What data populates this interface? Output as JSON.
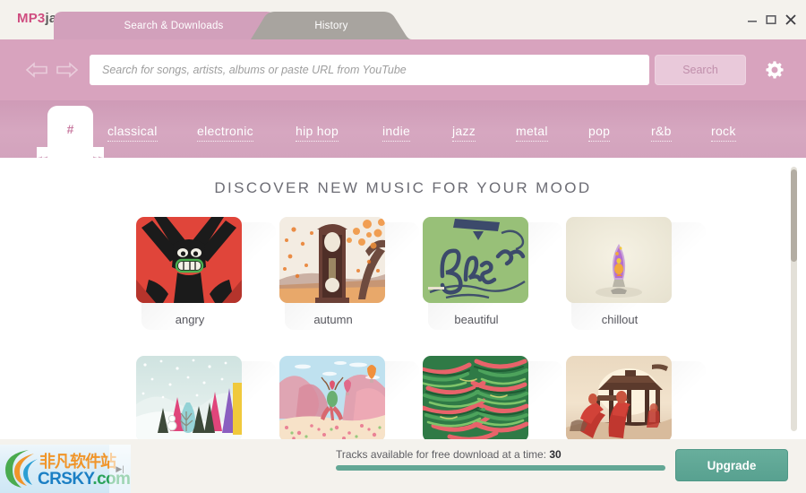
{
  "app": {
    "logo_mp3": "MP3",
    "logo_jam": "jam"
  },
  "window_controls": {
    "minimize": "minimize-icon",
    "maximize": "maximize-icon",
    "close": "close-icon"
  },
  "tabs": [
    {
      "label": "Search & Downloads",
      "active": true
    },
    {
      "label": "History",
      "active": false
    }
  ],
  "search": {
    "placeholder": "Search for songs, artists, albums or paste URL from YouTube",
    "value": "",
    "button_label": "Search",
    "back_icon": "arrow-left-icon",
    "forward_icon": "arrow-right-icon",
    "settings_icon": "gear-icon"
  },
  "genres": [
    {
      "label": "#",
      "active": true
    },
    {
      "label": "classical",
      "active": false
    },
    {
      "label": "electronic",
      "active": false
    },
    {
      "label": "hip hop",
      "active": false
    },
    {
      "label": "indie",
      "active": false
    },
    {
      "label": "jazz",
      "active": false
    },
    {
      "label": "metal",
      "active": false
    },
    {
      "label": "pop",
      "active": false
    },
    {
      "label": "r&b",
      "active": false
    },
    {
      "label": "rock",
      "active": false
    }
  ],
  "main": {
    "heading": "DISCOVER NEW MUSIC FOR YOUR MOOD",
    "moods_row1": [
      {
        "label": "angry"
      },
      {
        "label": "autumn"
      },
      {
        "label": "beautiful"
      },
      {
        "label": "chillout"
      }
    ],
    "moods_row2": [
      {
        "label": ""
      },
      {
        "label": ""
      },
      {
        "label": ""
      },
      {
        "label": ""
      }
    ]
  },
  "footer": {
    "tracks_text": "Tracks available for free download at a time:",
    "tracks_count": "30",
    "upgrade_label": "Upgrade",
    "progress_percent": "100"
  },
  "watermark": {
    "cn_text": "非凡软件站",
    "en_text_1": "CRSKY",
    "en_text_2": ".com",
    "play_icon": "play-icon"
  },
  "colors": {
    "brand_pink": "#cf4d80",
    "header_pink": "#d8a3be",
    "genre_pink": "#d4a1bb",
    "tab_active": "#d2a0bb",
    "tab_inactive": "#a8a49f",
    "accent_green": "#63a795",
    "bg_chrome": "#f4f2ed"
  }
}
